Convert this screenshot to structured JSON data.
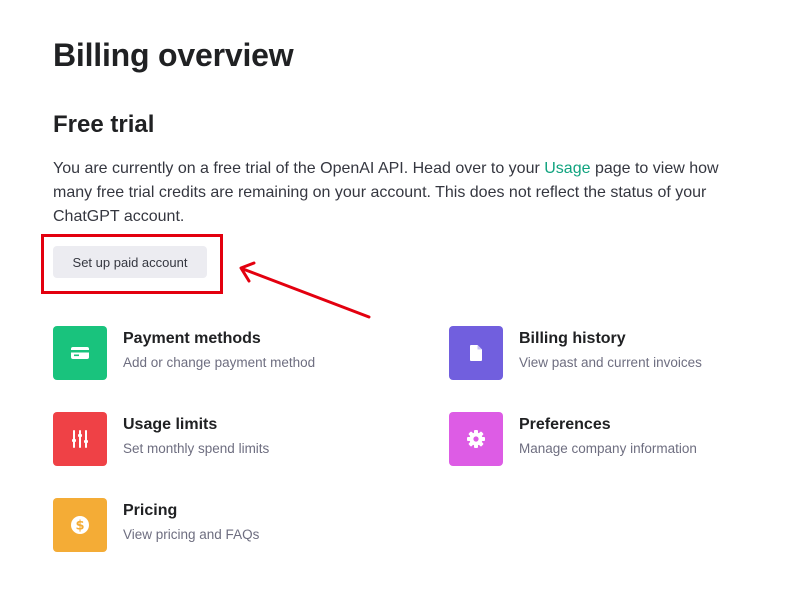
{
  "header": {
    "title": "Billing overview"
  },
  "free_trial": {
    "title": "Free trial",
    "text_before_link": "You are currently on a free trial of the OpenAI API. Head over to your ",
    "link_text": "Usage",
    "text_after_link": " page to view how many free trial credits are remaining on your account. This does not reflect the status of your ChatGPT account.",
    "button_label": "Set up paid account"
  },
  "cards": [
    {
      "title": "Payment methods",
      "description": "Add or change payment method",
      "icon": "credit-card-icon",
      "color": "#19c37d"
    },
    {
      "title": "Billing history",
      "description": "View past and current invoices",
      "icon": "document-icon",
      "color": "#715fde"
    },
    {
      "title": "Usage limits",
      "description": "Set monthly spend limits",
      "icon": "sliders-icon",
      "color": "#ef4146"
    },
    {
      "title": "Preferences",
      "description": "Manage company information",
      "icon": "gear-icon",
      "color": "#dd5ce5"
    },
    {
      "title": "Pricing",
      "description": "View pricing and FAQs",
      "icon": "dollar-icon",
      "color": "#f4ac36"
    }
  ],
  "colors": {
    "link": "#10a37f",
    "annotation": "#e3000f"
  }
}
